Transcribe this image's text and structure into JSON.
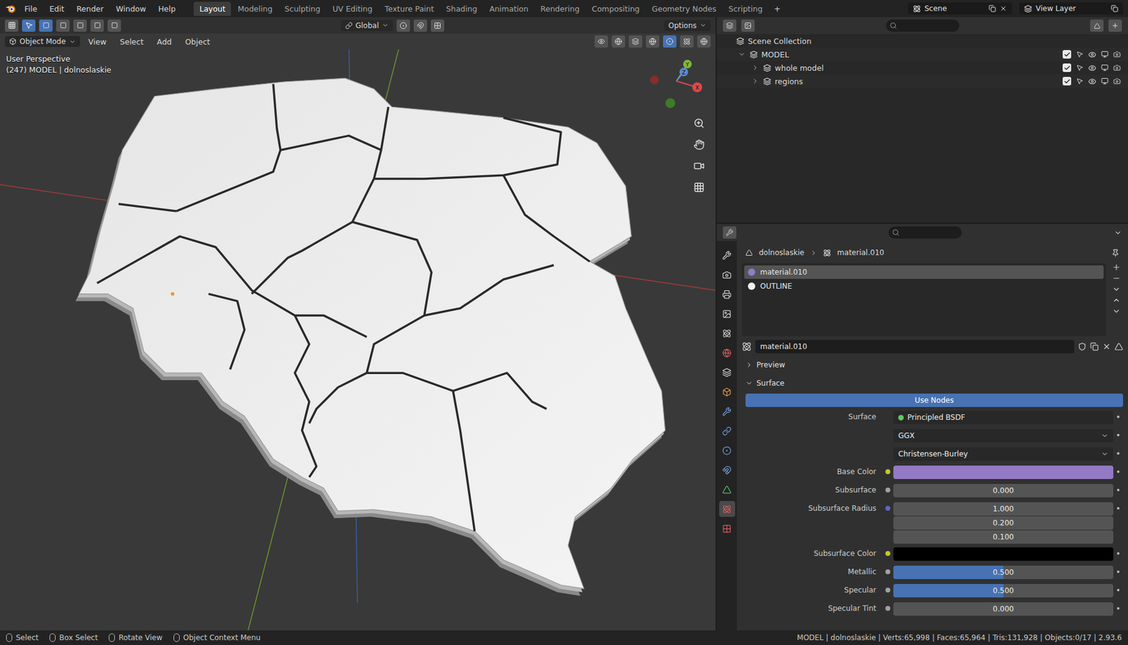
{
  "topbar": {
    "menus": [
      "File",
      "Edit",
      "Render",
      "Window",
      "Help"
    ],
    "workspaces": [
      {
        "label": "Layout",
        "selected": true
      },
      {
        "label": "Modeling",
        "selected": false
      },
      {
        "label": "Sculpting",
        "selected": false
      },
      {
        "label": "UV Editing",
        "selected": false
      },
      {
        "label": "Texture Paint",
        "selected": false
      },
      {
        "label": "Shading",
        "selected": false
      },
      {
        "label": "Animation",
        "selected": false
      },
      {
        "label": "Rendering",
        "selected": false
      },
      {
        "label": "Compositing",
        "selected": false
      },
      {
        "label": "Geometry Nodes",
        "selected": false
      },
      {
        "label": "Scripting",
        "selected": false
      }
    ],
    "add": "+",
    "scene": "Scene",
    "view_layer": "View Layer"
  },
  "viewport": {
    "orientation": "Global",
    "options": "Options",
    "mode": "Object Mode",
    "menus": [
      "View",
      "Select",
      "Add",
      "Object"
    ],
    "overlay": [
      "User Perspective",
      "(247) MODEL | dolnoslaskie"
    ],
    "gizmo": {
      "x": "X",
      "y": "Y",
      "z": "Z"
    }
  },
  "outliner": {
    "rows": [
      {
        "label": "Scene Collection",
        "depth": 0,
        "expandable": false,
        "expanded": true,
        "checked": false
      },
      {
        "label": "MODEL",
        "depth": 1,
        "expandable": true,
        "expanded": true,
        "checked": true
      },
      {
        "label": "whole model",
        "depth": 2,
        "expandable": true,
        "expanded": false,
        "checked": true
      },
      {
        "label": "regions",
        "depth": 2,
        "expandable": true,
        "expanded": false,
        "checked": true
      }
    ]
  },
  "properties": {
    "object": "dolnoslaskie",
    "material": "material.010",
    "slots": [
      {
        "label": "material.010",
        "selected": true,
        "color": "#8f7cc9"
      },
      {
        "label": "OUTLINE",
        "selected": false,
        "color": "#f0f0f0"
      }
    ],
    "material_field": "material.010",
    "panels": [
      {
        "label": "Preview",
        "expanded": false
      },
      {
        "label": "Surface",
        "expanded": true
      }
    ],
    "use_nodes": "Use Nodes",
    "fields": [
      {
        "kind": "node",
        "label": "Surface",
        "value": "Principled BSDF",
        "socket": "#63c763"
      },
      {
        "kind": "dropdown",
        "label": "",
        "value": "GGX",
        "socket": ""
      },
      {
        "kind": "dropdown",
        "label": "",
        "value": "Christensen-Burley",
        "socket": ""
      },
      {
        "kind": "color",
        "label": "Base Color",
        "value": "#9479c4",
        "socket": "#c7c729"
      },
      {
        "kind": "number",
        "label": "Subsurface",
        "value": "0.000",
        "socket": "#a1a1a1"
      },
      {
        "kind": "vector",
        "label": "Subsurface Radius",
        "values": [
          "1.000",
          "0.200",
          "0.100"
        ],
        "socket": "#6363c7"
      },
      {
        "kind": "color",
        "label": "Subsurface Color",
        "value": "#000000",
        "socket": "#c7c729"
      },
      {
        "kind": "slider",
        "label": "Metallic",
        "value": "0.500",
        "level": 0.5,
        "socket": "#a1a1a1"
      },
      {
        "kind": "slider",
        "label": "Specular",
        "value": "0.500",
        "level": 0.5,
        "socket": "#a1a1a1"
      },
      {
        "kind": "number",
        "label": "Specular Tint",
        "value": "0.000",
        "socket": "#a1a1a1"
      }
    ]
  },
  "status_bar": {
    "hints": [
      "Select",
      "Box Select",
      "Rotate View",
      "Object Context Menu"
    ],
    "stats": "MODEL | dolnoslaskie | Verts:65,998 | Faces:65,964 | Tris:131,928 | Objects:0/17 | 2.93.6"
  }
}
